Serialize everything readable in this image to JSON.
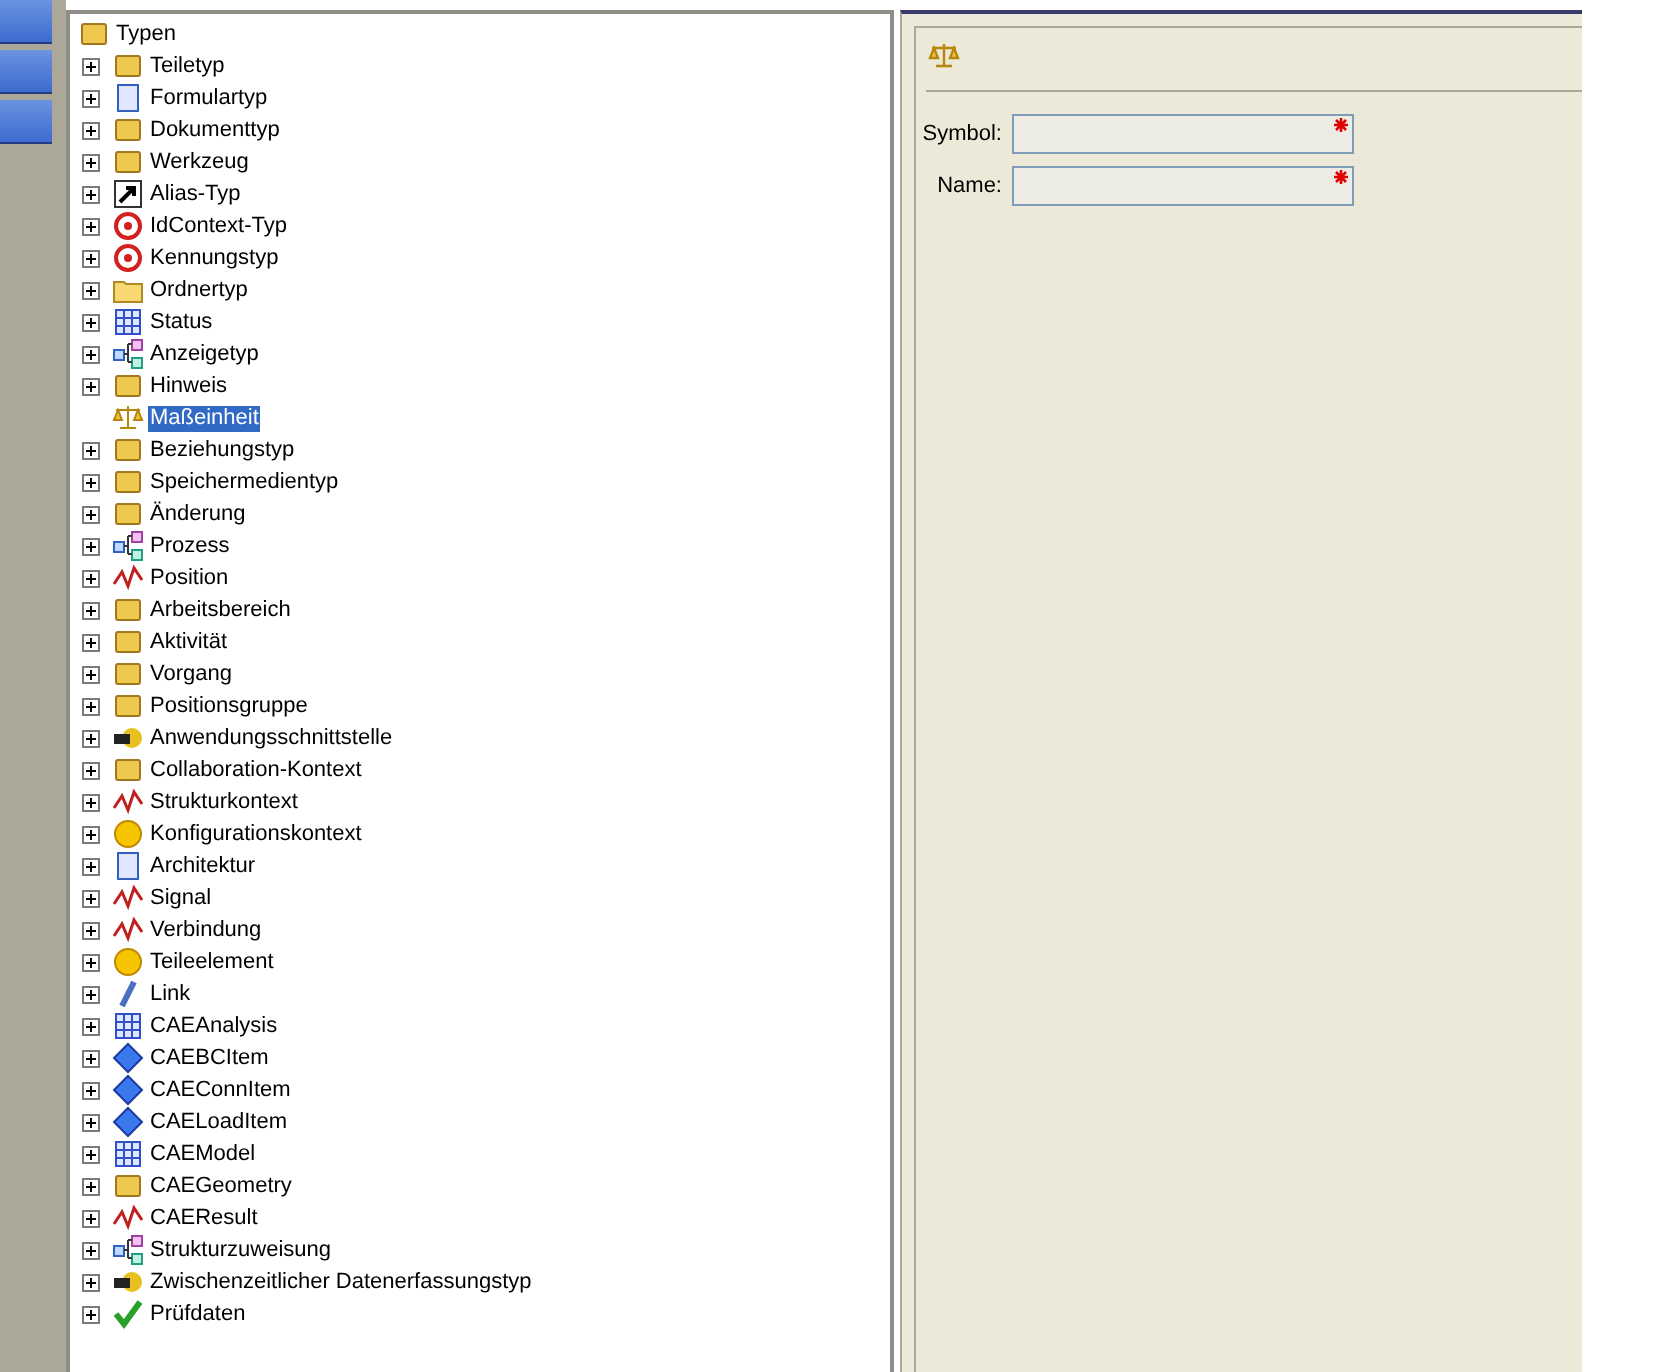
{
  "tree": {
    "label": "Typen",
    "children": [
      {
        "label": "Teiletyp",
        "expandable": true,
        "selected": false
      },
      {
        "label": "Formulartyp",
        "expandable": true,
        "selected": false
      },
      {
        "label": "Dokumenttyp",
        "expandable": true,
        "selected": false
      },
      {
        "label": "Werkzeug",
        "expandable": true,
        "selected": false
      },
      {
        "label": "Alias-Typ",
        "expandable": true,
        "selected": false
      },
      {
        "label": "IdContext-Typ",
        "expandable": true,
        "selected": false
      },
      {
        "label": "Kennungstyp",
        "expandable": true,
        "selected": false
      },
      {
        "label": "Ordnertyp",
        "expandable": true,
        "selected": false
      },
      {
        "label": "Status",
        "expandable": true,
        "selected": false
      },
      {
        "label": "Anzeigetyp",
        "expandable": true,
        "selected": false
      },
      {
        "label": "Hinweis",
        "expandable": true,
        "selected": false
      },
      {
        "label": "Maßeinheit",
        "expandable": false,
        "selected": true
      },
      {
        "label": "Beziehungstyp",
        "expandable": true,
        "selected": false
      },
      {
        "label": "Speichermedientyp",
        "expandable": true,
        "selected": false
      },
      {
        "label": "Änderung",
        "expandable": true,
        "selected": false
      },
      {
        "label": "Prozess",
        "expandable": true,
        "selected": false
      },
      {
        "label": "Position",
        "expandable": true,
        "selected": false
      },
      {
        "label": "Arbeitsbereich",
        "expandable": true,
        "selected": false
      },
      {
        "label": "Aktivität",
        "expandable": true,
        "selected": false
      },
      {
        "label": "Vorgang",
        "expandable": true,
        "selected": false
      },
      {
        "label": "Positionsgruppe",
        "expandable": true,
        "selected": false
      },
      {
        "label": "Anwendungsschnittstelle",
        "expandable": true,
        "selected": false
      },
      {
        "label": "Collaboration-Kontext",
        "expandable": true,
        "selected": false
      },
      {
        "label": "Strukturkontext",
        "expandable": true,
        "selected": false
      },
      {
        "label": "Konfigurationskontext",
        "expandable": true,
        "selected": false
      },
      {
        "label": "Architektur",
        "expandable": true,
        "selected": false
      },
      {
        "label": "Signal",
        "expandable": true,
        "selected": false
      },
      {
        "label": "Verbindung",
        "expandable": true,
        "selected": false
      },
      {
        "label": "Teileelement",
        "expandable": true,
        "selected": false
      },
      {
        "label": "Link",
        "expandable": true,
        "selected": false
      },
      {
        "label": "CAEAnalysis",
        "expandable": true,
        "selected": false
      },
      {
        "label": "CAEBCItem",
        "expandable": true,
        "selected": false
      },
      {
        "label": "CAEConnItem",
        "expandable": true,
        "selected": false
      },
      {
        "label": "CAELoadItem",
        "expandable": true,
        "selected": false
      },
      {
        "label": "CAEModel",
        "expandable": true,
        "selected": false
      },
      {
        "label": "CAEGeometry",
        "expandable": true,
        "selected": false
      },
      {
        "label": "CAEResult",
        "expandable": true,
        "selected": false
      },
      {
        "label": "Strukturzuweisung",
        "expandable": true,
        "selected": false
      },
      {
        "label": "Zwischenzeitlicher Datenerfassungstyp",
        "expandable": true,
        "selected": false
      },
      {
        "label": "Prüfdaten",
        "expandable": true,
        "selected": false
      }
    ]
  },
  "form": {
    "fields": [
      {
        "label": "Symbol:",
        "required": true
      },
      {
        "label": "Name:",
        "required": true
      }
    ]
  }
}
